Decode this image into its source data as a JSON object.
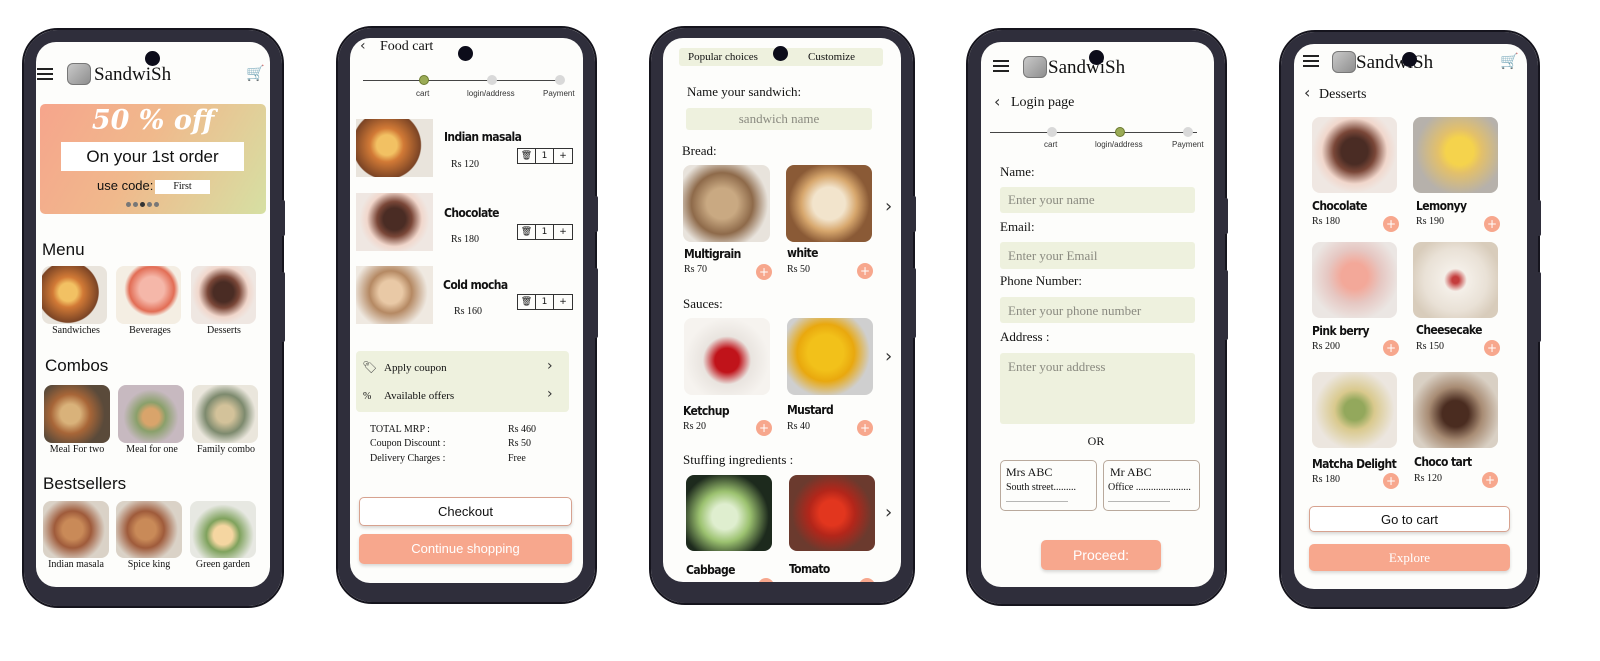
{
  "colors": {
    "accent": "#f7a78d",
    "field_bg": "#eef1de",
    "frame": "#2f2e3b",
    "active_step": "#9aab55"
  },
  "icons": {
    "menu": "hamburger-icon",
    "cart": "shopping-cart-icon",
    "back": "chevron-left-icon",
    "next": "chevron-right-icon",
    "coupon": "tag-icon",
    "delete": "trash-icon"
  },
  "screen1": {
    "brand": "SandwiSh",
    "banner": {
      "headline": "50 % off",
      "subline": "On your 1st order",
      "code_label": "use code:",
      "code_value": "First"
    },
    "menu_title": "Menu",
    "menu_items": [
      "Sandwiches",
      "Beverages",
      "Desserts"
    ],
    "combos_title": "Combos",
    "combo_items": [
      "Meal For two",
      "Meal for one",
      "Family combo"
    ],
    "bestsellers_title": "Bestsellers",
    "bestseller_items": [
      "Indian masala",
      "Spice king",
      "Green garden"
    ]
  },
  "screen2": {
    "title": "Food cart",
    "steps": [
      "cart",
      "login/address",
      "Payment"
    ],
    "items": [
      {
        "name": "Indian masala",
        "price": "Rs 120",
        "qty": "1"
      },
      {
        "name": "Chocolate",
        "price": "Rs 180",
        "qty": "1"
      },
      {
        "name": "Cold mocha",
        "price": "Rs 160",
        "qty": "1"
      }
    ],
    "qty_plus": "+",
    "apply_coupon": "Apply coupon",
    "offers_symbol": "%",
    "available_offers": "Available offers",
    "summary": [
      {
        "label": "TOTAL MRP :",
        "value": "Rs 460"
      },
      {
        "label": "Coupon Discount :",
        "value": "Rs 50"
      },
      {
        "label": "Delivery Charges :",
        "value": "Free"
      }
    ],
    "checkout": "Checkout",
    "continue": "Continue shopping"
  },
  "screen3": {
    "tabs": [
      "Popular choices",
      "Customize"
    ],
    "name_label": "Name your sandwich:",
    "name_placeholder": "sandwich name",
    "bread_title": "Bread:",
    "breads": [
      {
        "name": "Multigrain",
        "price": "Rs 70"
      },
      {
        "name": "white",
        "price": "Rs 50"
      }
    ],
    "sauces_title": "Sauces:",
    "sauces": [
      {
        "name": "Ketchup",
        "price": "Rs 20"
      },
      {
        "name": "Mustard",
        "price": "Rs 40"
      }
    ],
    "stuffing_title": "Stuffing ingredients :",
    "stuffing": [
      {
        "name": "Cabbage",
        "price": ""
      },
      {
        "name": "Tomato",
        "price": ""
      }
    ]
  },
  "screen4": {
    "brand": "SandwiSh",
    "title": "Login page",
    "steps": [
      "cart",
      "login/address",
      "Payment"
    ],
    "name_label": "Name:",
    "name_placeholder": "Enter your name",
    "email_label": "Email:",
    "email_placeholder": "Enter your Email",
    "phone_label": "Phone Number:",
    "phone_placeholder": "Enter your phone number",
    "address_label": "Address :",
    "address_placeholder": "Enter your address",
    "or": "OR",
    "saved": [
      {
        "name": "Mrs ABC",
        "line": "South street.........",
        "line2": "..............................."
      },
      {
        "name": "Mr ABC",
        "line": "Office ......................",
        "line2": "..............................."
      }
    ],
    "proceed": "Proceed:"
  },
  "screen5": {
    "brand": "SandwiSh",
    "title": "Desserts",
    "items": [
      {
        "name": "Chocolate",
        "price": "Rs 180"
      },
      {
        "name": "Lemonyy",
        "price": "Rs 190"
      },
      {
        "name": "Pink berry",
        "price": "Rs 200"
      },
      {
        "name": "Cheesecake",
        "price": "Rs 150"
      },
      {
        "name": "Matcha Delight",
        "price": "Rs 180"
      },
      {
        "name": "Choco tart",
        "price": "Rs 120"
      }
    ],
    "go_to_cart": "Go to cart",
    "explore": "Explore"
  }
}
